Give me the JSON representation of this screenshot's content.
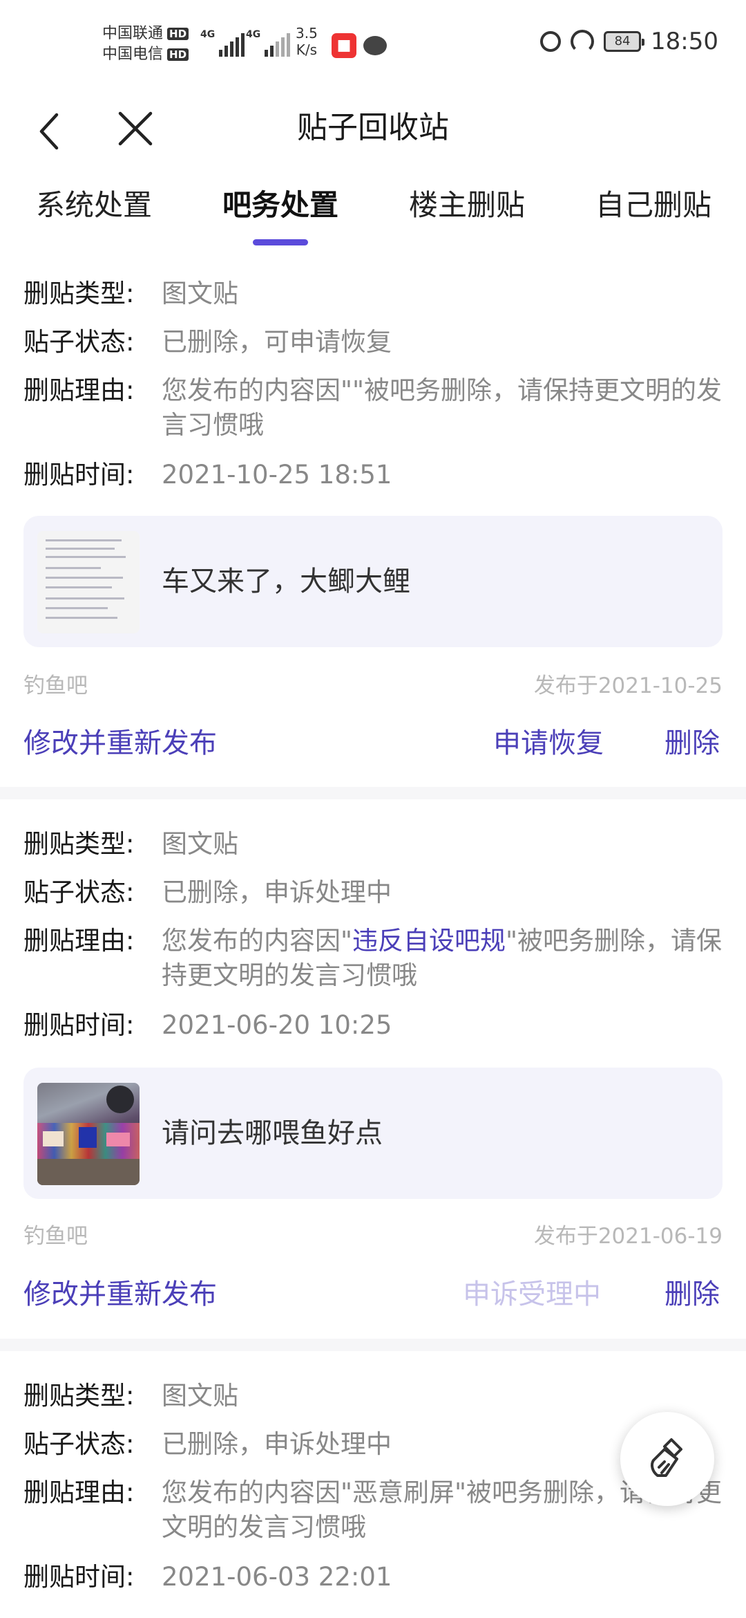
{
  "status_bar": {
    "carrier1": "中国联通",
    "carrier2": "中国电信",
    "hd": "HD",
    "net1": "4G",
    "net2": "4G",
    "speed_value": "3.5",
    "speed_unit": "K/s",
    "battery": "84",
    "time": "18:50"
  },
  "header": {
    "title": "贴子回收站"
  },
  "tabs": [
    "系统处置",
    "吧务处置",
    "楼主删贴",
    "自己删贴"
  ],
  "active_tab": 1,
  "labels": {
    "type": "删贴类型:",
    "status": "贴子状态:",
    "reason": "删贴理由:",
    "time": "删贴时间:"
  },
  "cards": [
    {
      "type": "图文贴",
      "status": "已删除，可申请恢复",
      "reason_prefix": "您发布的内容因\"\"被吧务删除，请保持更文明的发言习惯哦",
      "reason_highlight": "",
      "reason_suffix": "",
      "time": "2021-10-25 18:51",
      "post_title": "车又来了，大鲫大鲤",
      "forum": "钓鱼吧",
      "published": "发布于2021-10-25",
      "action_edit": "修改并重新发布",
      "action_middle": "申请恢复",
      "action_delete": "删除"
    },
    {
      "type": "图文贴",
      "status": "已删除，申诉处理中",
      "reason_prefix": "您发布的内容因\"",
      "reason_highlight": "违反自设吧规",
      "reason_suffix": "\"被吧务删除，请保持更文明的发言习惯哦",
      "time": "2021-06-20 10:25",
      "post_title": "请问去哪喂鱼好点",
      "forum": "钓鱼吧",
      "published": "发布于2021-06-19",
      "action_edit": "修改并重新发布",
      "action_middle": "申诉受理中",
      "action_delete": "删除"
    },
    {
      "type": "图文贴",
      "status": "已删除，申诉处理中",
      "reason_prefix": "您发布的内容因\"恶意刷屏\"被吧务删除，请保持更文明的发言习惯哦",
      "reason_highlight": "",
      "reason_suffix": "",
      "time": "2021-06-03 22:01"
    }
  ],
  "fab_icon": "broom-icon",
  "colors": {
    "accent": "#5b4bdb",
    "link": "#4b3fb8",
    "muted": "#888888"
  }
}
